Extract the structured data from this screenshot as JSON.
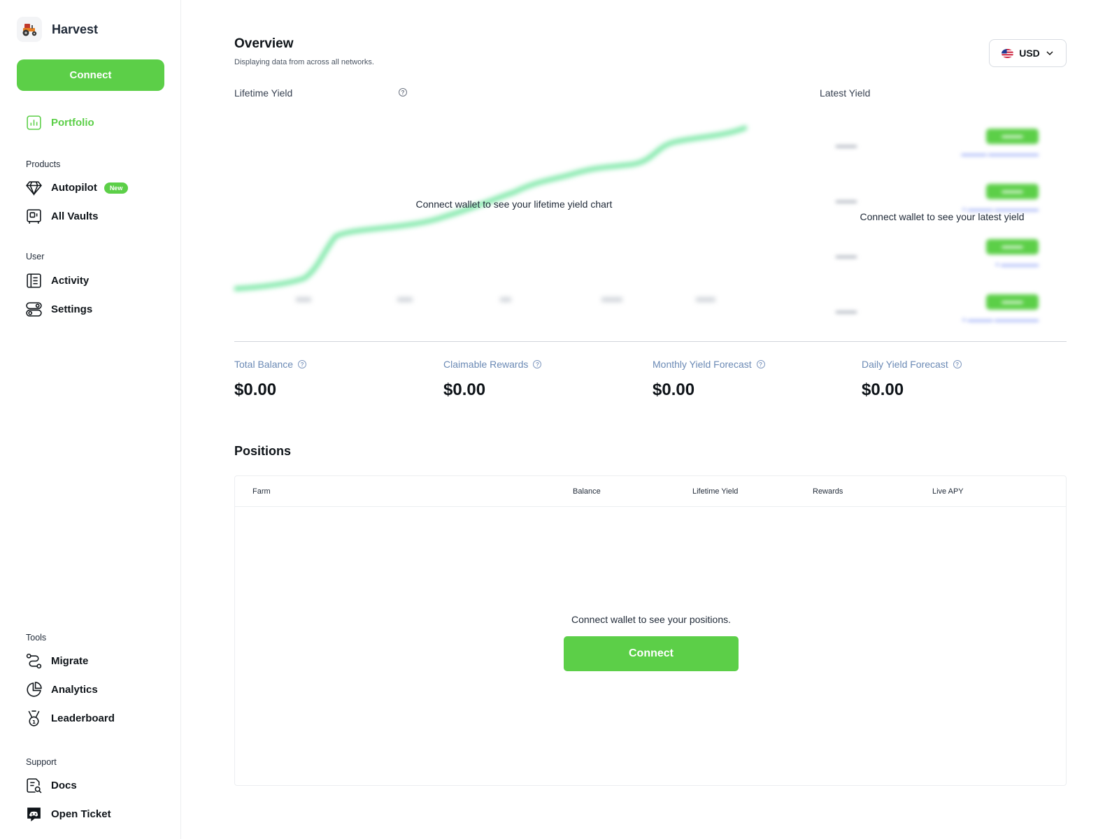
{
  "brand": {
    "name": "Harvest"
  },
  "sidebar": {
    "connect_label": "Connect",
    "portfolio_label": "Portfolio",
    "sections": {
      "products": "Products",
      "user": "User",
      "tools": "Tools",
      "support": "Support"
    },
    "items": {
      "autopilot": "Autopilot",
      "autopilot_badge": "New",
      "all_vaults": "All Vaults",
      "activity": "Activity",
      "settings": "Settings",
      "migrate": "Migrate",
      "analytics": "Analytics",
      "leaderboard": "Leaderboard",
      "docs": "Docs",
      "open_ticket": "Open Ticket"
    }
  },
  "header": {
    "title": "Overview",
    "subtitle": "Displaying data from across all networks.",
    "currency": "USD"
  },
  "lifetime_yield": {
    "label": "Lifetime Yield",
    "empty_message": "Connect wallet to see your lifetime yield chart"
  },
  "latest_yield": {
    "label": "Latest Yield",
    "empty_message": "Connect wallet to see your latest yield"
  },
  "stats": [
    {
      "label": "Total Balance",
      "value": "$0.00"
    },
    {
      "label": "Claimable Rewards",
      "value": "$0.00"
    },
    {
      "label": "Monthly Yield Forecast",
      "value": "$0.00"
    },
    {
      "label": "Daily Yield Forecast",
      "value": "$0.00"
    }
  ],
  "positions": {
    "title": "Positions",
    "columns": [
      "Farm",
      "Balance",
      "Lifetime Yield",
      "Rewards",
      "Live APY"
    ],
    "empty_message": "Connect wallet to see your positions.",
    "connect_label": "Connect"
  },
  "colors": {
    "accent": "#5ccf48",
    "stat_label": "#6b8ab5",
    "chart_line": "#7ee8a8"
  }
}
